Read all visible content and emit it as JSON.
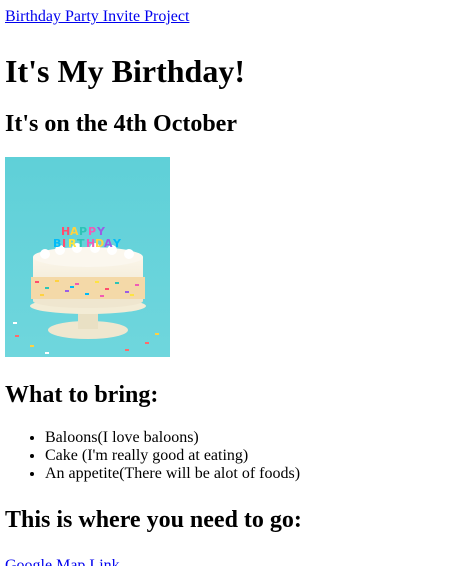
{
  "nav": {
    "project_link": "Birthday Party Invite Project"
  },
  "header": {
    "title": "It's My Birthday!",
    "date": "It's on the 4th October"
  },
  "image": {
    "alt": "Birthday cake with HAPPY BIRTHDAY candles"
  },
  "bring": {
    "heading": "What to bring:",
    "items": [
      "Baloons(I love baloons)",
      "Cake (I'm really good at eating)",
      "An appetite(There will be alot of foods)"
    ]
  },
  "location": {
    "heading": "This is where you need to go:",
    "map_link": "Google Map Link"
  }
}
